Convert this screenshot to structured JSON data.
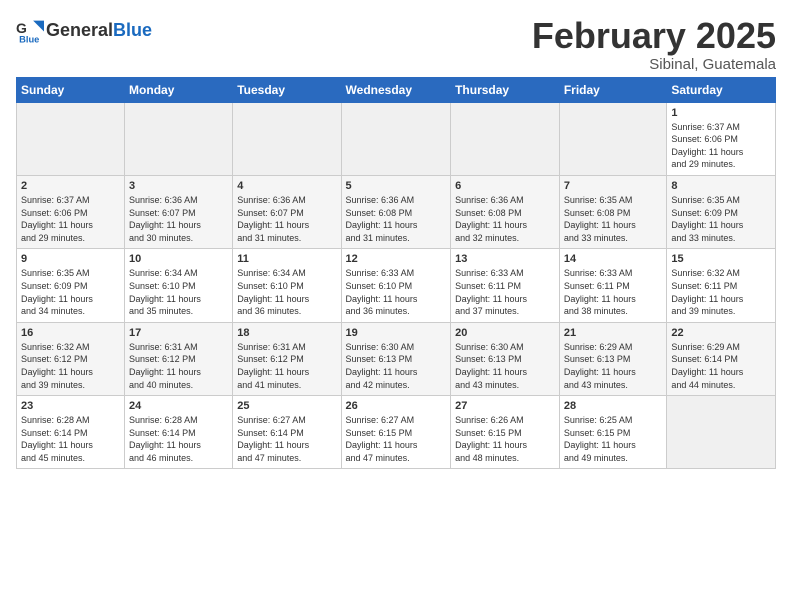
{
  "logo": {
    "text_general": "General",
    "text_blue": "Blue"
  },
  "header": {
    "month_year": "February 2025",
    "location": "Sibinal, Guatemala"
  },
  "weekdays": [
    "Sunday",
    "Monday",
    "Tuesday",
    "Wednesday",
    "Thursday",
    "Friday",
    "Saturday"
  ],
  "weeks": [
    [
      {
        "day": "",
        "info": ""
      },
      {
        "day": "",
        "info": ""
      },
      {
        "day": "",
        "info": ""
      },
      {
        "day": "",
        "info": ""
      },
      {
        "day": "",
        "info": ""
      },
      {
        "day": "",
        "info": ""
      },
      {
        "day": "1",
        "info": "Sunrise: 6:37 AM\nSunset: 6:06 PM\nDaylight: 11 hours\nand 29 minutes."
      }
    ],
    [
      {
        "day": "2",
        "info": "Sunrise: 6:37 AM\nSunset: 6:06 PM\nDaylight: 11 hours\nand 29 minutes."
      },
      {
        "day": "3",
        "info": "Sunrise: 6:36 AM\nSunset: 6:07 PM\nDaylight: 11 hours\nand 30 minutes."
      },
      {
        "day": "4",
        "info": "Sunrise: 6:36 AM\nSunset: 6:07 PM\nDaylight: 11 hours\nand 31 minutes."
      },
      {
        "day": "5",
        "info": "Sunrise: 6:36 AM\nSunset: 6:08 PM\nDaylight: 11 hours\nand 31 minutes."
      },
      {
        "day": "6",
        "info": "Sunrise: 6:36 AM\nSunset: 6:08 PM\nDaylight: 11 hours\nand 32 minutes."
      },
      {
        "day": "7",
        "info": "Sunrise: 6:35 AM\nSunset: 6:08 PM\nDaylight: 11 hours\nand 33 minutes."
      },
      {
        "day": "8",
        "info": "Sunrise: 6:35 AM\nSunset: 6:09 PM\nDaylight: 11 hours\nand 33 minutes."
      }
    ],
    [
      {
        "day": "9",
        "info": "Sunrise: 6:35 AM\nSunset: 6:09 PM\nDaylight: 11 hours\nand 34 minutes."
      },
      {
        "day": "10",
        "info": "Sunrise: 6:34 AM\nSunset: 6:10 PM\nDaylight: 11 hours\nand 35 minutes."
      },
      {
        "day": "11",
        "info": "Sunrise: 6:34 AM\nSunset: 6:10 PM\nDaylight: 11 hours\nand 36 minutes."
      },
      {
        "day": "12",
        "info": "Sunrise: 6:33 AM\nSunset: 6:10 PM\nDaylight: 11 hours\nand 36 minutes."
      },
      {
        "day": "13",
        "info": "Sunrise: 6:33 AM\nSunset: 6:11 PM\nDaylight: 11 hours\nand 37 minutes."
      },
      {
        "day": "14",
        "info": "Sunrise: 6:33 AM\nSunset: 6:11 PM\nDaylight: 11 hours\nand 38 minutes."
      },
      {
        "day": "15",
        "info": "Sunrise: 6:32 AM\nSunset: 6:11 PM\nDaylight: 11 hours\nand 39 minutes."
      }
    ],
    [
      {
        "day": "16",
        "info": "Sunrise: 6:32 AM\nSunset: 6:12 PM\nDaylight: 11 hours\nand 39 minutes."
      },
      {
        "day": "17",
        "info": "Sunrise: 6:31 AM\nSunset: 6:12 PM\nDaylight: 11 hours\nand 40 minutes."
      },
      {
        "day": "18",
        "info": "Sunrise: 6:31 AM\nSunset: 6:12 PM\nDaylight: 11 hours\nand 41 minutes."
      },
      {
        "day": "19",
        "info": "Sunrise: 6:30 AM\nSunset: 6:13 PM\nDaylight: 11 hours\nand 42 minutes."
      },
      {
        "day": "20",
        "info": "Sunrise: 6:30 AM\nSunset: 6:13 PM\nDaylight: 11 hours\nand 43 minutes."
      },
      {
        "day": "21",
        "info": "Sunrise: 6:29 AM\nSunset: 6:13 PM\nDaylight: 11 hours\nand 43 minutes."
      },
      {
        "day": "22",
        "info": "Sunrise: 6:29 AM\nSunset: 6:14 PM\nDaylight: 11 hours\nand 44 minutes."
      }
    ],
    [
      {
        "day": "23",
        "info": "Sunrise: 6:28 AM\nSunset: 6:14 PM\nDaylight: 11 hours\nand 45 minutes."
      },
      {
        "day": "24",
        "info": "Sunrise: 6:28 AM\nSunset: 6:14 PM\nDaylight: 11 hours\nand 46 minutes."
      },
      {
        "day": "25",
        "info": "Sunrise: 6:27 AM\nSunset: 6:14 PM\nDaylight: 11 hours\nand 47 minutes."
      },
      {
        "day": "26",
        "info": "Sunrise: 6:27 AM\nSunset: 6:15 PM\nDaylight: 11 hours\nand 47 minutes."
      },
      {
        "day": "27",
        "info": "Sunrise: 6:26 AM\nSunset: 6:15 PM\nDaylight: 11 hours\nand 48 minutes."
      },
      {
        "day": "28",
        "info": "Sunrise: 6:25 AM\nSunset: 6:15 PM\nDaylight: 11 hours\nand 49 minutes."
      },
      {
        "day": "",
        "info": ""
      }
    ]
  ]
}
